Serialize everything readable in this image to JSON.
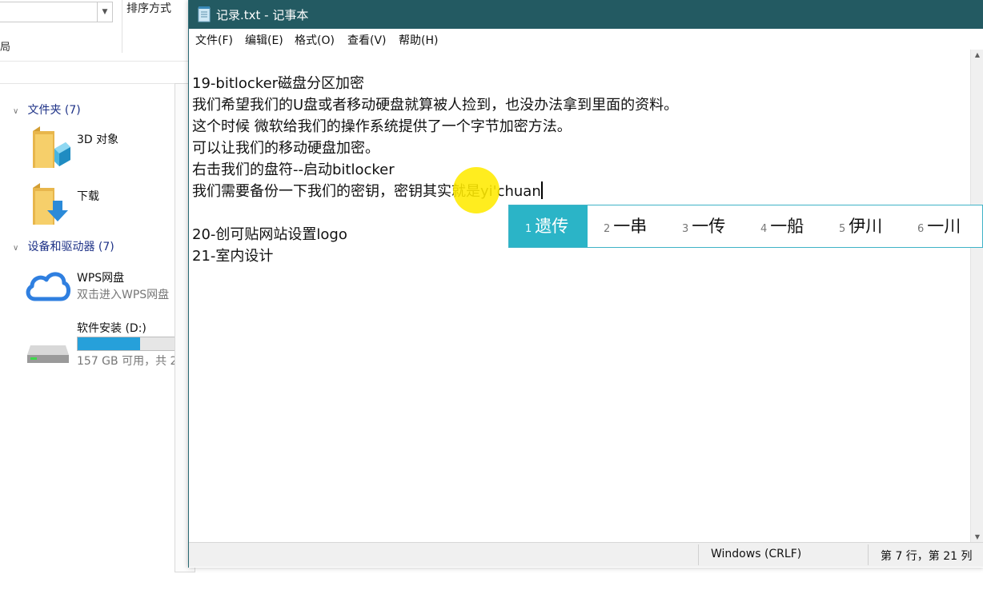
{
  "explorer": {
    "ribbon": {
      "sort_label": "排序方式",
      "layout_fragment": "局"
    },
    "groups": [
      {
        "label": "文件夹 (7)"
      },
      {
        "label": "设备和驱动器 (7)"
      }
    ],
    "folders": [
      {
        "label": "3D 对象",
        "icon": "3d-objects-folder-icon"
      },
      {
        "label": "下载",
        "icon": "downloads-folder-icon"
      }
    ],
    "devices": [
      {
        "label": "WPS网盘",
        "sub": "双击进入WPS网盘",
        "icon": "wps-cloud-icon"
      },
      {
        "label": "软件安装 (D:)",
        "sub": "157 GB 可用，共 2",
        "icon": "drive-icon",
        "used_fraction": 0.6
      }
    ]
  },
  "notepad": {
    "title": "记录.txt - 记事本",
    "menu": [
      "文件(F)",
      "编辑(E)",
      "格式(O)",
      "查看(V)",
      "帮助(H)"
    ],
    "lines": [
      "19-bitlocker磁盘分区加密",
      "我们希望我们的U盘或者移动硬盘就算被人捡到，也没办法拿到里面的资料。",
      "这个时候 微软给我们的操作系统提供了一个字节加密方法。",
      "可以让我们的移动硬盘加密。",
      "右击我们的盘符--启动bitlocker",
      "我们需要备份一下我们的密钥，密钥其实就是yi'chuan",
      "",
      "20-创可贴网站设置logo",
      "21-室内设计"
    ],
    "status": {
      "line_ending": "Windows (CRLF)",
      "position": "第 7 行，第 21 列"
    }
  },
  "ime": {
    "selected_index": 0,
    "candidates": [
      {
        "num": "1",
        "text": "遗传"
      },
      {
        "num": "2",
        "text": "一串"
      },
      {
        "num": "3",
        "text": "一传"
      },
      {
        "num": "4",
        "text": "一船"
      },
      {
        "num": "5",
        "text": "伊川"
      },
      {
        "num": "6",
        "text": "一川"
      }
    ]
  },
  "colors": {
    "titlebar": "#235a62",
    "ime_selected": "#2bb4c7",
    "cursor_highlight": "#ffea00",
    "drive_bar": "#26a0da"
  }
}
